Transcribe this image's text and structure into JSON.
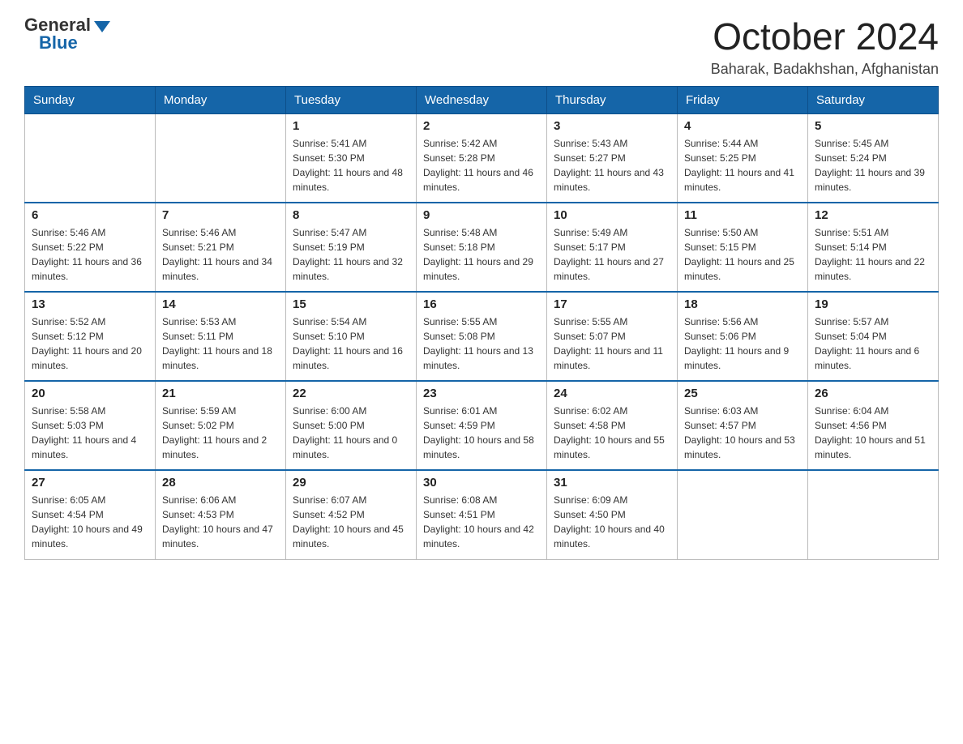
{
  "header": {
    "logo_general": "General",
    "logo_blue": "Blue",
    "month_year": "October 2024",
    "location": "Baharak, Badakhshan, Afghanistan"
  },
  "days_of_week": [
    "Sunday",
    "Monday",
    "Tuesday",
    "Wednesday",
    "Thursday",
    "Friday",
    "Saturday"
  ],
  "weeks": [
    [
      {
        "day": "",
        "sunrise": "",
        "sunset": "",
        "daylight": ""
      },
      {
        "day": "",
        "sunrise": "",
        "sunset": "",
        "daylight": ""
      },
      {
        "day": "1",
        "sunrise": "Sunrise: 5:41 AM",
        "sunset": "Sunset: 5:30 PM",
        "daylight": "Daylight: 11 hours and 48 minutes."
      },
      {
        "day": "2",
        "sunrise": "Sunrise: 5:42 AM",
        "sunset": "Sunset: 5:28 PM",
        "daylight": "Daylight: 11 hours and 46 minutes."
      },
      {
        "day": "3",
        "sunrise": "Sunrise: 5:43 AM",
        "sunset": "Sunset: 5:27 PM",
        "daylight": "Daylight: 11 hours and 43 minutes."
      },
      {
        "day": "4",
        "sunrise": "Sunrise: 5:44 AM",
        "sunset": "Sunset: 5:25 PM",
        "daylight": "Daylight: 11 hours and 41 minutes."
      },
      {
        "day": "5",
        "sunrise": "Sunrise: 5:45 AM",
        "sunset": "Sunset: 5:24 PM",
        "daylight": "Daylight: 11 hours and 39 minutes."
      }
    ],
    [
      {
        "day": "6",
        "sunrise": "Sunrise: 5:46 AM",
        "sunset": "Sunset: 5:22 PM",
        "daylight": "Daylight: 11 hours and 36 minutes."
      },
      {
        "day": "7",
        "sunrise": "Sunrise: 5:46 AM",
        "sunset": "Sunset: 5:21 PM",
        "daylight": "Daylight: 11 hours and 34 minutes."
      },
      {
        "day": "8",
        "sunrise": "Sunrise: 5:47 AM",
        "sunset": "Sunset: 5:19 PM",
        "daylight": "Daylight: 11 hours and 32 minutes."
      },
      {
        "day": "9",
        "sunrise": "Sunrise: 5:48 AM",
        "sunset": "Sunset: 5:18 PM",
        "daylight": "Daylight: 11 hours and 29 minutes."
      },
      {
        "day": "10",
        "sunrise": "Sunrise: 5:49 AM",
        "sunset": "Sunset: 5:17 PM",
        "daylight": "Daylight: 11 hours and 27 minutes."
      },
      {
        "day": "11",
        "sunrise": "Sunrise: 5:50 AM",
        "sunset": "Sunset: 5:15 PM",
        "daylight": "Daylight: 11 hours and 25 minutes."
      },
      {
        "day": "12",
        "sunrise": "Sunrise: 5:51 AM",
        "sunset": "Sunset: 5:14 PM",
        "daylight": "Daylight: 11 hours and 22 minutes."
      }
    ],
    [
      {
        "day": "13",
        "sunrise": "Sunrise: 5:52 AM",
        "sunset": "Sunset: 5:12 PM",
        "daylight": "Daylight: 11 hours and 20 minutes."
      },
      {
        "day": "14",
        "sunrise": "Sunrise: 5:53 AM",
        "sunset": "Sunset: 5:11 PM",
        "daylight": "Daylight: 11 hours and 18 minutes."
      },
      {
        "day": "15",
        "sunrise": "Sunrise: 5:54 AM",
        "sunset": "Sunset: 5:10 PM",
        "daylight": "Daylight: 11 hours and 16 minutes."
      },
      {
        "day": "16",
        "sunrise": "Sunrise: 5:55 AM",
        "sunset": "Sunset: 5:08 PM",
        "daylight": "Daylight: 11 hours and 13 minutes."
      },
      {
        "day": "17",
        "sunrise": "Sunrise: 5:55 AM",
        "sunset": "Sunset: 5:07 PM",
        "daylight": "Daylight: 11 hours and 11 minutes."
      },
      {
        "day": "18",
        "sunrise": "Sunrise: 5:56 AM",
        "sunset": "Sunset: 5:06 PM",
        "daylight": "Daylight: 11 hours and 9 minutes."
      },
      {
        "day": "19",
        "sunrise": "Sunrise: 5:57 AM",
        "sunset": "Sunset: 5:04 PM",
        "daylight": "Daylight: 11 hours and 6 minutes."
      }
    ],
    [
      {
        "day": "20",
        "sunrise": "Sunrise: 5:58 AM",
        "sunset": "Sunset: 5:03 PM",
        "daylight": "Daylight: 11 hours and 4 minutes."
      },
      {
        "day": "21",
        "sunrise": "Sunrise: 5:59 AM",
        "sunset": "Sunset: 5:02 PM",
        "daylight": "Daylight: 11 hours and 2 minutes."
      },
      {
        "day": "22",
        "sunrise": "Sunrise: 6:00 AM",
        "sunset": "Sunset: 5:00 PM",
        "daylight": "Daylight: 11 hours and 0 minutes."
      },
      {
        "day": "23",
        "sunrise": "Sunrise: 6:01 AM",
        "sunset": "Sunset: 4:59 PM",
        "daylight": "Daylight: 10 hours and 58 minutes."
      },
      {
        "day": "24",
        "sunrise": "Sunrise: 6:02 AM",
        "sunset": "Sunset: 4:58 PM",
        "daylight": "Daylight: 10 hours and 55 minutes."
      },
      {
        "day": "25",
        "sunrise": "Sunrise: 6:03 AM",
        "sunset": "Sunset: 4:57 PM",
        "daylight": "Daylight: 10 hours and 53 minutes."
      },
      {
        "day": "26",
        "sunrise": "Sunrise: 6:04 AM",
        "sunset": "Sunset: 4:56 PM",
        "daylight": "Daylight: 10 hours and 51 minutes."
      }
    ],
    [
      {
        "day": "27",
        "sunrise": "Sunrise: 6:05 AM",
        "sunset": "Sunset: 4:54 PM",
        "daylight": "Daylight: 10 hours and 49 minutes."
      },
      {
        "day": "28",
        "sunrise": "Sunrise: 6:06 AM",
        "sunset": "Sunset: 4:53 PM",
        "daylight": "Daylight: 10 hours and 47 minutes."
      },
      {
        "day": "29",
        "sunrise": "Sunrise: 6:07 AM",
        "sunset": "Sunset: 4:52 PM",
        "daylight": "Daylight: 10 hours and 45 minutes."
      },
      {
        "day": "30",
        "sunrise": "Sunrise: 6:08 AM",
        "sunset": "Sunset: 4:51 PM",
        "daylight": "Daylight: 10 hours and 42 minutes."
      },
      {
        "day": "31",
        "sunrise": "Sunrise: 6:09 AM",
        "sunset": "Sunset: 4:50 PM",
        "daylight": "Daylight: 10 hours and 40 minutes."
      },
      {
        "day": "",
        "sunrise": "",
        "sunset": "",
        "daylight": ""
      },
      {
        "day": "",
        "sunrise": "",
        "sunset": "",
        "daylight": ""
      }
    ]
  ]
}
